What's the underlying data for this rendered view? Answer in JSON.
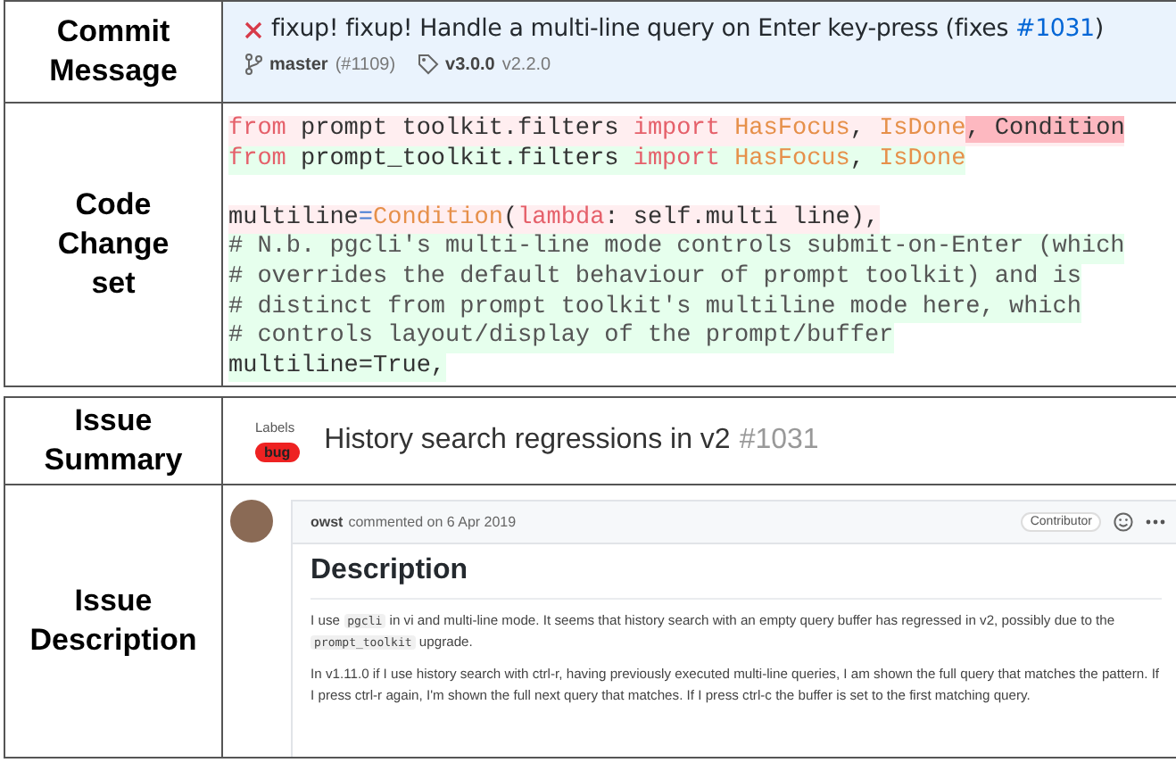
{
  "commit_table": {
    "rows": [
      {
        "kind": "commit",
        "header": "Commit Message"
      },
      {
        "kind": "code",
        "header": "Code Change set"
      }
    ]
  },
  "commit": {
    "failed": true,
    "title": "fixup! fixup! Handle a multi-line query on Enter key-press (fixes",
    "link": "#1031",
    "title_end": ")",
    "branch": "master",
    "pr": "(#1109)",
    "tag": "v3.0.0",
    "tag_old": "v2.2.0"
  },
  "code_lines": [
    {
      "kind": "removed",
      "tokens": [
        {
          "kind": "keyword",
          "text": "from"
        },
        {
          "kind": "plain",
          "text": " prompt toolkit.filters "
        },
        {
          "kind": "keyword",
          "text": "import "
        },
        {
          "kind": "name",
          "text": "HasFocus"
        },
        {
          "kind": "plain",
          "text": ", "
        },
        {
          "kind": "name",
          "text": "IsDone"
        },
        {
          "kind": "emphasis",
          "text": ", Condition"
        }
      ]
    },
    {
      "kind": "added",
      "tokens": [
        {
          "kind": "keyword",
          "text": "from"
        },
        {
          "kind": "plain",
          "text": " prompt_toolkit.filters "
        },
        {
          "kind": "keyword",
          "text": "import "
        },
        {
          "kind": "name",
          "text": "HasFocus"
        },
        {
          "kind": "plain",
          "text": ", "
        },
        {
          "kind": "name",
          "text": "IsDone"
        }
      ]
    },
    {
      "kind": "blank"
    },
    {
      "kind": "removed",
      "tokens": [
        {
          "kind": "plain",
          "text": "multiline"
        },
        {
          "kind": "operator",
          "text": "="
        },
        {
          "kind": "name",
          "text": "Condition"
        },
        {
          "kind": "plain",
          "text": "("
        },
        {
          "kind": "keyword",
          "text": "lambda"
        },
        {
          "kind": "plain",
          "text": ": self.multi line),"
        }
      ]
    },
    {
      "kind": "added",
      "tokens": [
        {
          "kind": "comment",
          "text": "# N.b. pgcli's multi-line mode controls submit-on-Enter (which"
        }
      ]
    },
    {
      "kind": "added",
      "tokens": [
        {
          "kind": "comment",
          "text": "# overrides the default behaviour of prompt toolkit) and is"
        }
      ]
    },
    {
      "kind": "added",
      "tokens": [
        {
          "kind": "comment",
          "text": "# distinct from prompt toolkit's multiline mode here, which"
        }
      ]
    },
    {
      "kind": "added",
      "tokens": [
        {
          "kind": "comment",
          "text": "# controls layout/display of the prompt/buffer"
        }
      ]
    },
    {
      "kind": "added",
      "tokens": [
        {
          "kind": "plain",
          "text": "multiline=True,"
        }
      ]
    }
  ],
  "issue_table": {
    "rows": [
      {
        "kind": "summary",
        "header": "Issue Summary"
      },
      {
        "kind": "description",
        "header": "Issue Description"
      }
    ]
  },
  "issue": {
    "labels_heading": "Labels",
    "labels": [
      {
        "text": "bug",
        "color": "#ee2222"
      }
    ],
    "title": "History search regressions in v2",
    "number": "#1031"
  },
  "comment": {
    "author": "owst",
    "meta": "commented on 6 Apr 2019",
    "role": "Contributor",
    "heading": "Description",
    "paragraphs": [
      [
        {
          "kind": "text",
          "text": "I use "
        },
        {
          "kind": "code",
          "text": "pgcli"
        },
        {
          "kind": "text",
          "text": " in vi and multi-line mode. It seems that history search with an empty query buffer has regressed in v2, possibly due to the "
        },
        {
          "kind": "code",
          "text": "prompt_toolkit"
        },
        {
          "kind": "text",
          "text": " upgrade."
        }
      ],
      [
        {
          "kind": "text",
          "text": "In v1.11.0 if I use history search with ctrl-r, having previously executed multi-line queries, I am shown the full query that matches the pattern. If I press ctrl-r again, I'm shown the full next query that matches. If I press ctrl-c the buffer is set to the first matching query."
        }
      ]
    ]
  }
}
